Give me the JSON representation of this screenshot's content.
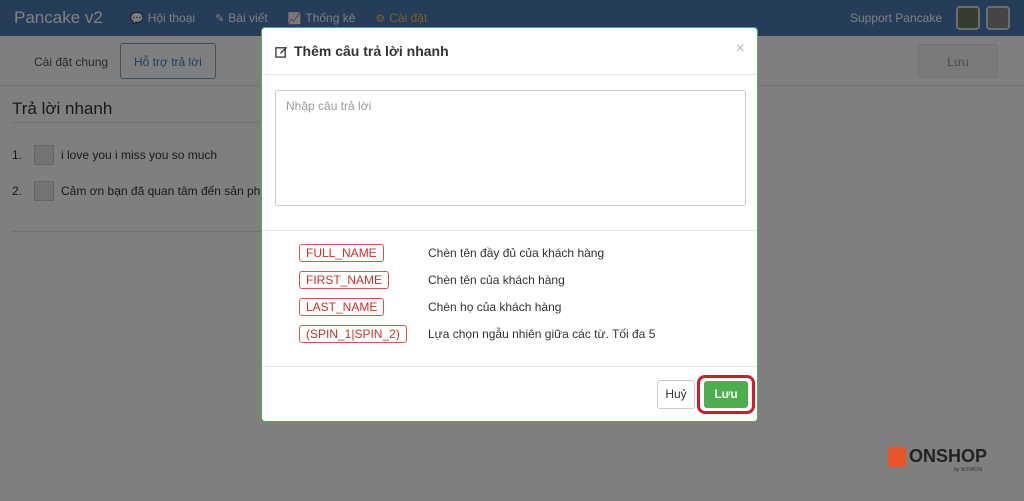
{
  "navbar": {
    "brand": "Pancake v2",
    "items": [
      {
        "label": "Hội thoại",
        "icon": "chat-icon"
      },
      {
        "label": "Bài viết",
        "icon": "edit-icon"
      },
      {
        "label": "Thống kê",
        "icon": "chart-icon"
      },
      {
        "label": "Cài đặt",
        "icon": "gear-icon",
        "active": true
      }
    ],
    "user_name": "Support Pancake"
  },
  "subbar": {
    "tabs": [
      {
        "label": "Cài đặt chung"
      },
      {
        "label": "Hỗ trợ trả lời",
        "active": true
      }
    ],
    "save_label": "Lưu"
  },
  "page": {
    "section_title": "Trả lời nhanh",
    "replies": [
      {
        "num": "1.",
        "text": "i love you i miss you so much"
      },
      {
        "num": "2.",
        "text": "Cảm ơn bạn đã quan tâm đến sản phẩ"
      }
    ]
  },
  "modal": {
    "title": "Thêm câu trả lời nhanh",
    "close_label": "×",
    "input_placeholder": "Nhập câu trả lời",
    "input_value": "",
    "variables": [
      {
        "tag": "FULL_NAME",
        "desc": "Chèn tên đầy đủ của khách hàng"
      },
      {
        "tag": "FIRST_NAME",
        "desc": "Chèn tên của khách hàng"
      },
      {
        "tag": "LAST_NAME",
        "desc": "Chèn họ của khách hàng"
      },
      {
        "tag": "(SPIN_1|SPIN_2)",
        "desc": "Lựa chọn ngẫu nhiên giữa các từ. Tối đa 5"
      }
    ],
    "cancel_label": "Huỷ",
    "save_label": "Lưu"
  },
  "logo": {
    "text": "ONSHOP",
    "sub": "by NOVAON"
  },
  "colors": {
    "navbar": "#4b7bb3",
    "active_nav": "#f5c343",
    "save_button": "#4cae4c",
    "tag_border": "#d9534f",
    "highlight": "#d51a2b"
  }
}
